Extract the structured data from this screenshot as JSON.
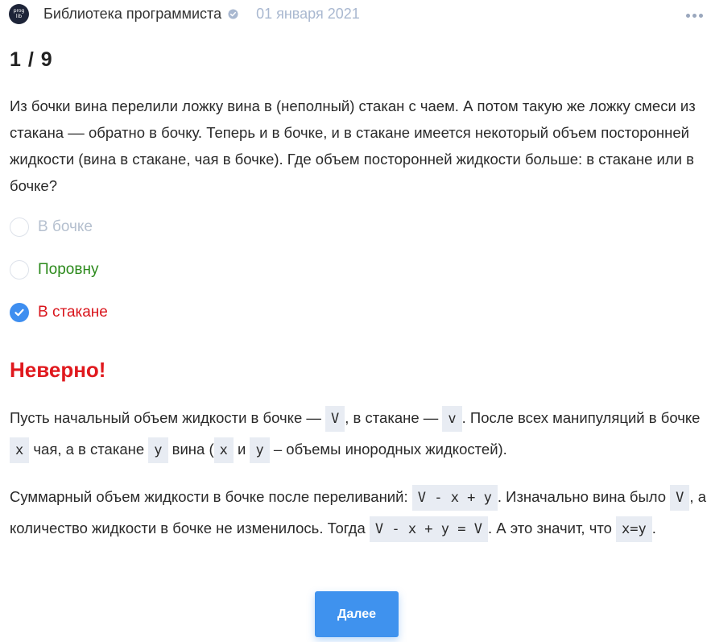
{
  "header": {
    "avatar_text": [
      "prog",
      "lib"
    ],
    "channel_name": "Библиотека программиста",
    "date": "01 января 2021"
  },
  "quiz": {
    "counter": "1 / 9",
    "question": "Из бочки вина перелили ложку вина в (неполный) стакан с чаем. А потом такую же ложку смеси из стакана –– обратно в бочку. Теперь и в бочке, и в стакане имеется некоторый объем посторонней жидкости (вина в стакане, чая в бочке). Где объем посторонней жидкости больше: в стакане или в бочке?",
    "options": [
      {
        "label": "В бочке",
        "state": "neutral"
      },
      {
        "label": "Поровну",
        "state": "correct"
      },
      {
        "label": "В стакане",
        "state": "selected-wrong"
      }
    ],
    "verdict": "Неверно!",
    "explanation": {
      "p1": {
        "t1": "Пусть начальный объем жидкости в бочке — ",
        "c1": "V",
        "t2": ", в стакане — ",
        "c2": "v",
        "t3": ". После всех манипуляций в бочке ",
        "c3": "x",
        "t4": " чая, а в стакане ",
        "c4": "y",
        "t5": " вина (",
        "c5": "x",
        "t6": " и ",
        "c6": "y",
        "t7": " – объемы инородных жидкостей)."
      },
      "p2": {
        "t1": "Суммарный объем жидкости в бочке после переливаний: ",
        "c1": "V - x + y",
        "t2": ". Изначально вина было ",
        "c2": "V",
        "t3": ", а количество жидкости в бочке не изменилось. Тогда ",
        "c3": "V - x + y = V",
        "t4": ". А это значит, что ",
        "c4": "x=y",
        "t5": "."
      }
    },
    "next_button": "Далее"
  },
  "colors": {
    "accent": "#3e8ef0",
    "correct": "#2c8a1c",
    "wrong": "#d9151c",
    "muted": "#b5c0cf"
  }
}
